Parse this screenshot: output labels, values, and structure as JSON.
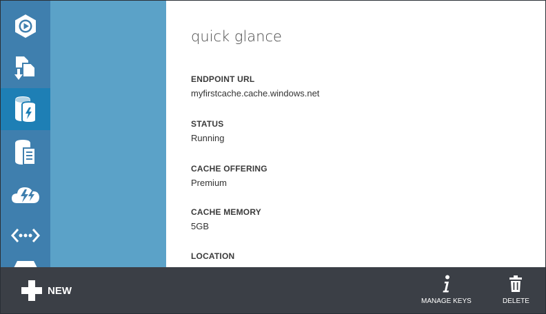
{
  "sidebar": {
    "items": [
      {
        "icon": "media-play-icon",
        "selected": false
      },
      {
        "icon": "import-export-icon",
        "selected": false
      },
      {
        "icon": "cache-icon",
        "selected": true
      },
      {
        "icon": "sql-database-icon",
        "selected": false
      },
      {
        "icon": "cloud-services-icon",
        "selected": false
      },
      {
        "icon": "api-management-icon",
        "selected": false
      },
      {
        "icon": "tag-icon",
        "selected": false
      }
    ]
  },
  "content": {
    "title": "quick glance",
    "fields": [
      {
        "label": "ENDPOINT URL",
        "value": "myfirstcache.cache.windows.net"
      },
      {
        "label": "STATUS",
        "value": "Running"
      },
      {
        "label": "CACHE OFFERING",
        "value": "Premium"
      },
      {
        "label": "CACHE MEMORY",
        "value": "5GB"
      },
      {
        "label": "LOCATION",
        "value": ""
      }
    ]
  },
  "commandbar": {
    "new_label": "NEW",
    "manage_keys_label": "MANAGE KEYS",
    "delete_label": "DELETE"
  },
  "colors": {
    "sidebar": "#3f7fae",
    "sidebar_selected": "#1e7fb5",
    "panel": "#5ba2c8",
    "commandbar": "#3b3f46"
  }
}
